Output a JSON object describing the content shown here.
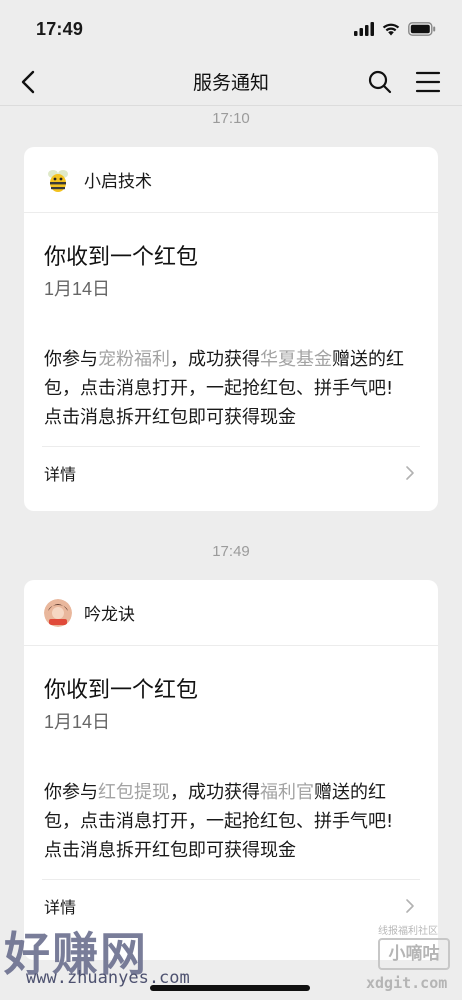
{
  "status": {
    "time": "17:49"
  },
  "nav": {
    "title": "服务通知"
  },
  "messages": [
    {
      "timestamp": "17:10",
      "sender": "小启技术",
      "title": "你收到一个红包",
      "date": "1月14日",
      "body": {
        "p1": "你参与",
        "h1": "宠粉福利",
        "p2": "，成功获得",
        "h2": "华夏基金",
        "p3": "赠送的红包，点击消息打开，一起抢红包、拼手气吧!",
        "line2": "点击消息拆开红包即可获得现金"
      },
      "detail": "详情"
    },
    {
      "timestamp": "17:49",
      "sender": "吟龙诀",
      "title": "你收到一个红包",
      "date": "1月14日",
      "body": {
        "p1": "你参与",
        "h1": "红包提现",
        "p2": "，成功获得",
        "h2": "福利官",
        "p3": "赠送的红包，点击消息打开，一起抢红包、拼手气吧!",
        "line2": "点击消息拆开红包即可获得现金"
      },
      "detail": "详情"
    }
  ],
  "watermark": {
    "brand": "好赚网",
    "url": "www.zhuanyes.com",
    "badge_small": "线报福利社区",
    "badge": "小嘀咕",
    "badge_url": "xdgit.com"
  },
  "colors": {
    "background": "#ededed",
    "card": "#ffffff",
    "highlight": "#a3a3a3",
    "brand": "#6b6f8e"
  }
}
